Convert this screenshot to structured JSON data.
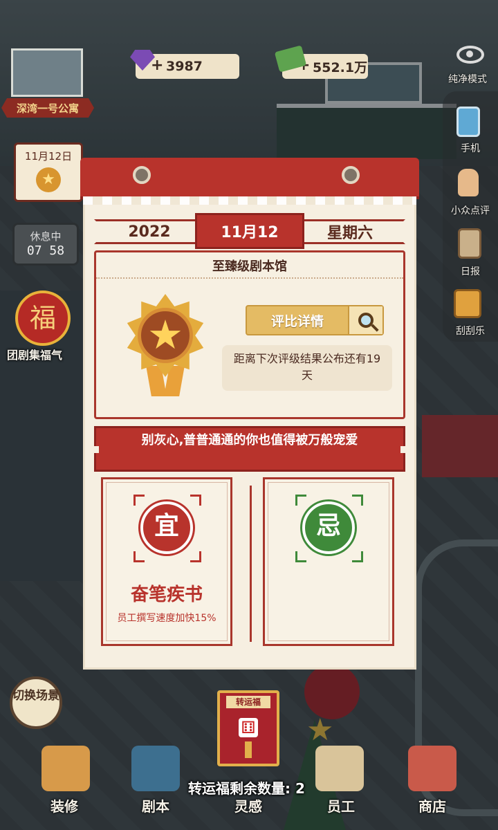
{
  "hud": {
    "gems": "3987",
    "cash": "552.1万",
    "plus": "+",
    "building_name": "深湾一号公寓",
    "mini_calendar_date": "11月12日",
    "rest_status": "休息中",
    "rest_time": "07 58",
    "fu_glyph": "福",
    "fu_event_label": "团剧集福气"
  },
  "side_menu": {
    "pure_mode": "纯净模式",
    "items": [
      {
        "label": "手机",
        "icon": "phone-icon"
      },
      {
        "label": "小众点评",
        "icon": "thumb-icon"
      },
      {
        "label": "日报",
        "icon": "clipboard-icon"
      },
      {
        "label": "刮刮乐",
        "icon": "scratch-card-icon"
      }
    ]
  },
  "calendar": {
    "year": "2022",
    "date": "11月12",
    "weekday": "星期六",
    "rank_title": "至臻级剧本馆",
    "detail_button": "评比详情",
    "next_rating": "距离下次评级结果公布还有19天",
    "slogan": "别灰心,普普通通的你也值得被万般宠爱",
    "yi": {
      "seal": "宜",
      "name": "奋笔疾书",
      "desc": "员工撰写速度加快15%"
    },
    "ji": {
      "seal": "忌"
    }
  },
  "lucky": {
    "card_title": "转运福",
    "count_label": "转运福剩余数量:",
    "count": "2"
  },
  "switch_scene": "切换场景",
  "bottom_nav": [
    {
      "label": "装修",
      "icon": "house-icon"
    },
    {
      "label": "剧本",
      "icon": "script-book-icon"
    },
    {
      "label": "灵感",
      "icon": "inspiration-icon"
    },
    {
      "label": "员工",
      "icon": "staff-card-icon"
    },
    {
      "label": "商店",
      "icon": "shop-icon"
    }
  ],
  "colors": {
    "calendar_red": "#b8332c",
    "paper": "#f6efe1",
    "ji_green": "#3f8a3a",
    "gold": "#e4bb64"
  }
}
